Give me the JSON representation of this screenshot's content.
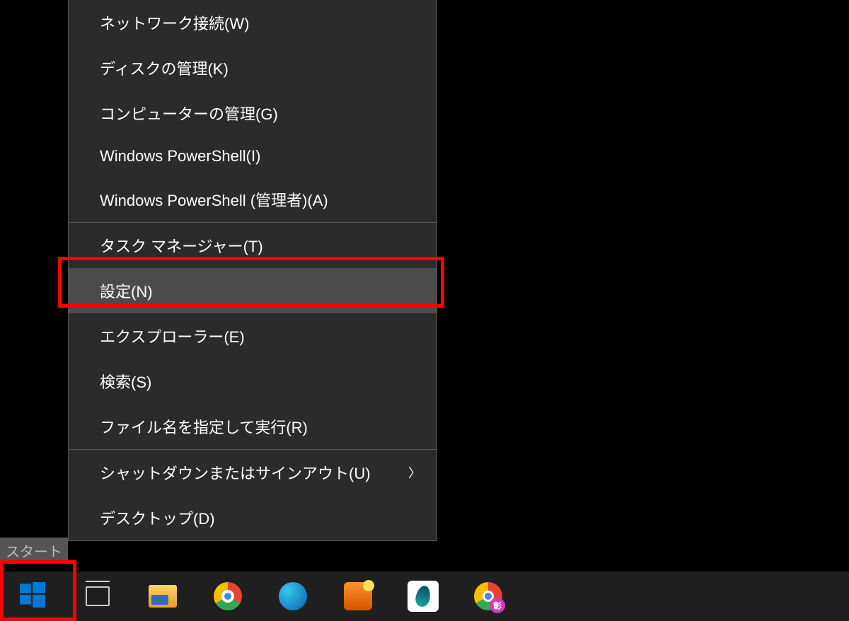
{
  "tooltip": {
    "start_label": "スタート"
  },
  "menu": {
    "items": [
      {
        "label": "ネットワーク接続(W)"
      },
      {
        "label": "ディスクの管理(K)"
      },
      {
        "label": "コンピューターの管理(G)"
      },
      {
        "label": "Windows PowerShell(I)"
      },
      {
        "label": "Windows PowerShell (管理者)(A)"
      }
    ],
    "items2": [
      {
        "label": "タスク マネージャー(T)"
      },
      {
        "label": "設定(N)",
        "highlighted": true
      },
      {
        "label": "エクスプローラー(E)"
      },
      {
        "label": "検索(S)"
      },
      {
        "label": "ファイル名を指定して実行(R)"
      }
    ],
    "items3": [
      {
        "label": "シャットダウンまたはサインアウト(U)",
        "submenu": true
      },
      {
        "label": "デスクトップ(D)"
      }
    ]
  },
  "taskbar": {
    "chrome_badge": "彰"
  }
}
